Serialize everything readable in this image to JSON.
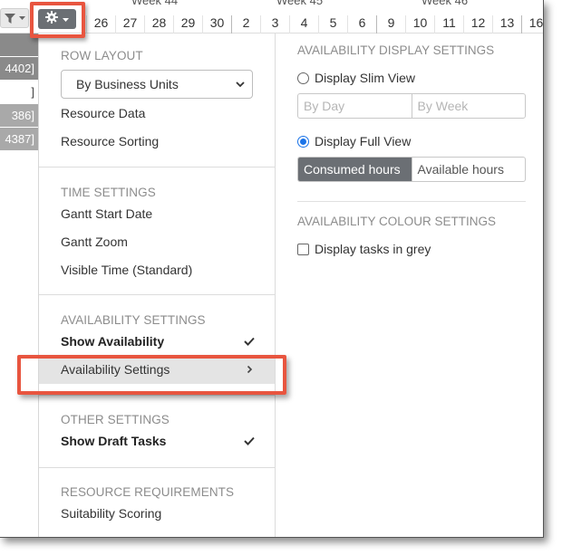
{
  "gantt": {
    "weeks": [
      "Week 44",
      "Week 45",
      "Week 46"
    ],
    "days": [
      "26",
      "27",
      "28",
      "29",
      "30",
      "2",
      "3",
      "4",
      "5",
      "6",
      "9",
      "10",
      "11",
      "12",
      "13",
      "16"
    ],
    "left_rows": [
      "",
      "4402]",
      "]",
      "386]",
      "4387]"
    ]
  },
  "toolbar": {
    "filter_icon": "filter-icon",
    "gear_icon": "gear-icon"
  },
  "row_layout": {
    "title": "ROW LAYOUT",
    "select_value": "By Business Units",
    "items": [
      "Resource Data",
      "Resource Sorting"
    ]
  },
  "time_settings": {
    "title": "TIME SETTINGS",
    "items": [
      "Gantt Start Date",
      "Gantt Zoom",
      "Visible Time (Standard)"
    ]
  },
  "availability_settings": {
    "title": "AVAILABILITY SETTINGS",
    "show_availability": "Show Availability",
    "settings_item": "Availability Settings"
  },
  "other_settings": {
    "title": "OTHER SETTINGS",
    "show_draft_tasks": "Show Draft Tasks"
  },
  "resource_requirements": {
    "title": "RESOURCE REQUIREMENTS",
    "item": "Suitability Scoring"
  },
  "display_settings": {
    "title": "AVAILABILITY DISPLAY SETTINGS",
    "slim_view_label": "Display Slim View",
    "slim_options": [
      "By Day",
      "By Week"
    ],
    "full_view_label": "Display Full View",
    "full_options": [
      "Consumed hours",
      "Available hours"
    ]
  },
  "colour_settings": {
    "title": "AVAILABILITY COLOUR SETTINGS",
    "grey_tasks_label": "Display tasks in grey"
  },
  "colors": {
    "highlight": "#e8553f",
    "selected_segment": "#6b6f74",
    "radio_selected": "#1a73e8"
  }
}
